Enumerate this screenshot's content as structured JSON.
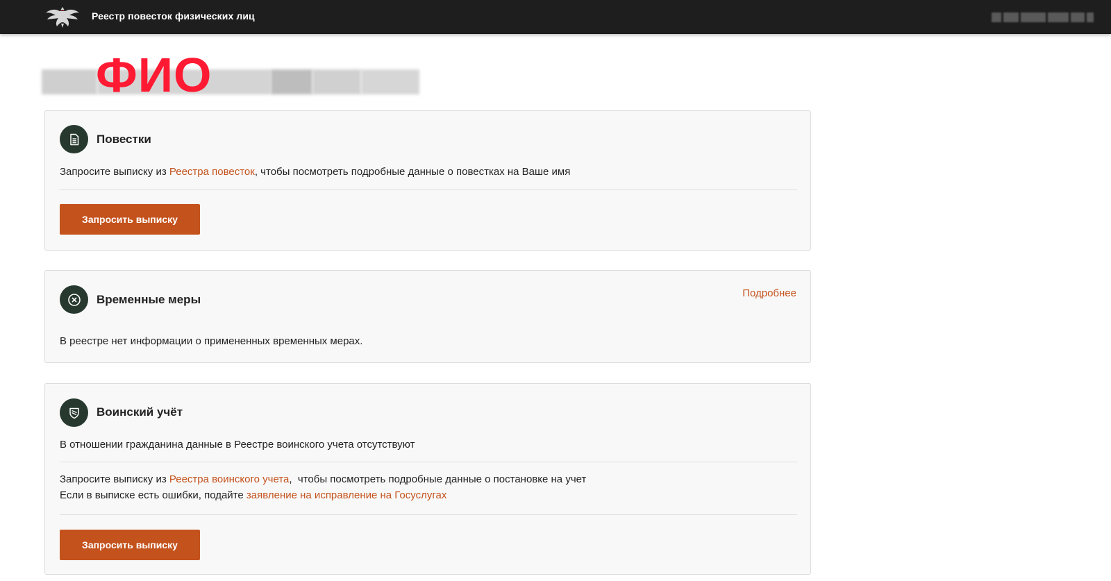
{
  "header": {
    "title": "Реестр повесток физических лиц",
    "logo_icon": "eagle-emblem-icon",
    "user_name_redacted": true
  },
  "profile": {
    "fio_label": "ФИО",
    "fio_redacted": true
  },
  "cards": {
    "summons": {
      "icon": "document-icon",
      "title": "Повестки",
      "text_before": "Запросите выписку из ",
      "link": "Реестра повесток",
      "text_after": ", чтобы посмотреть подробные данные о повестках на Ваше имя",
      "button": "Запросить выписку"
    },
    "temporary_measures": {
      "icon": "cross-circle-icon",
      "title": "Временные меры",
      "more_link": "Подробнее",
      "text": "В реестре нет информации о примененных временных мерах."
    },
    "military_record": {
      "icon": "shield-icon",
      "title": "Воинский учёт",
      "status_text": "В отношении гражданина данные в Реестре воинского учета отсутствуют",
      "request_before": "Запросите выписку из ",
      "request_link": "Реестра воинского учета",
      "request_after": ",  чтобы посмотреть подробные данные о постановке на учет",
      "errors_before": "Если в выписке есть ошибки, подайте ",
      "errors_link": "заявление на исправление на Госуслугах",
      "button": "Запросить выписку"
    }
  },
  "colors": {
    "header_bg": "#1e1e1e",
    "accent": "#c4521c",
    "icon_bg": "#27392f",
    "card_bg": "#f8f8f8",
    "fio_label": "#ff1a33"
  }
}
